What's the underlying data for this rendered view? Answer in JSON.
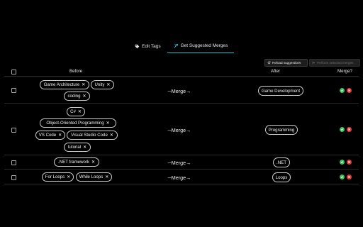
{
  "tabs": [
    {
      "label": "Edit Tags",
      "icon": "tag-icon"
    },
    {
      "label": "Get Suggested Merges",
      "icon": "merge-icon",
      "active": true
    }
  ],
  "toolbar": {
    "reload_label": "Reload suggestions",
    "perform_label": "Perform selected merges"
  },
  "table": {
    "headers": {
      "before": "Before",
      "after": "After",
      "merge": "Merge?"
    },
    "arrow": "─Merge→",
    "rows": [
      {
        "before": [
          "Game Architecture",
          "Unity",
          "coding"
        ],
        "after": "Game Development"
      },
      {
        "before": [
          "C#",
          "Object-Oriented Programming",
          "VS Code",
          "Visual Studio Code",
          "tutorial"
        ],
        "after": "Programming"
      },
      {
        "before": [
          ".NET framework"
        ],
        "after": ".NET"
      },
      {
        "before": [
          "For Loops",
          "While Loops"
        ],
        "after": "Loops"
      }
    ]
  },
  "colors": {
    "accent": "#3fb6c4",
    "accept": "#3ec35a",
    "reject": "#e33a3a"
  }
}
